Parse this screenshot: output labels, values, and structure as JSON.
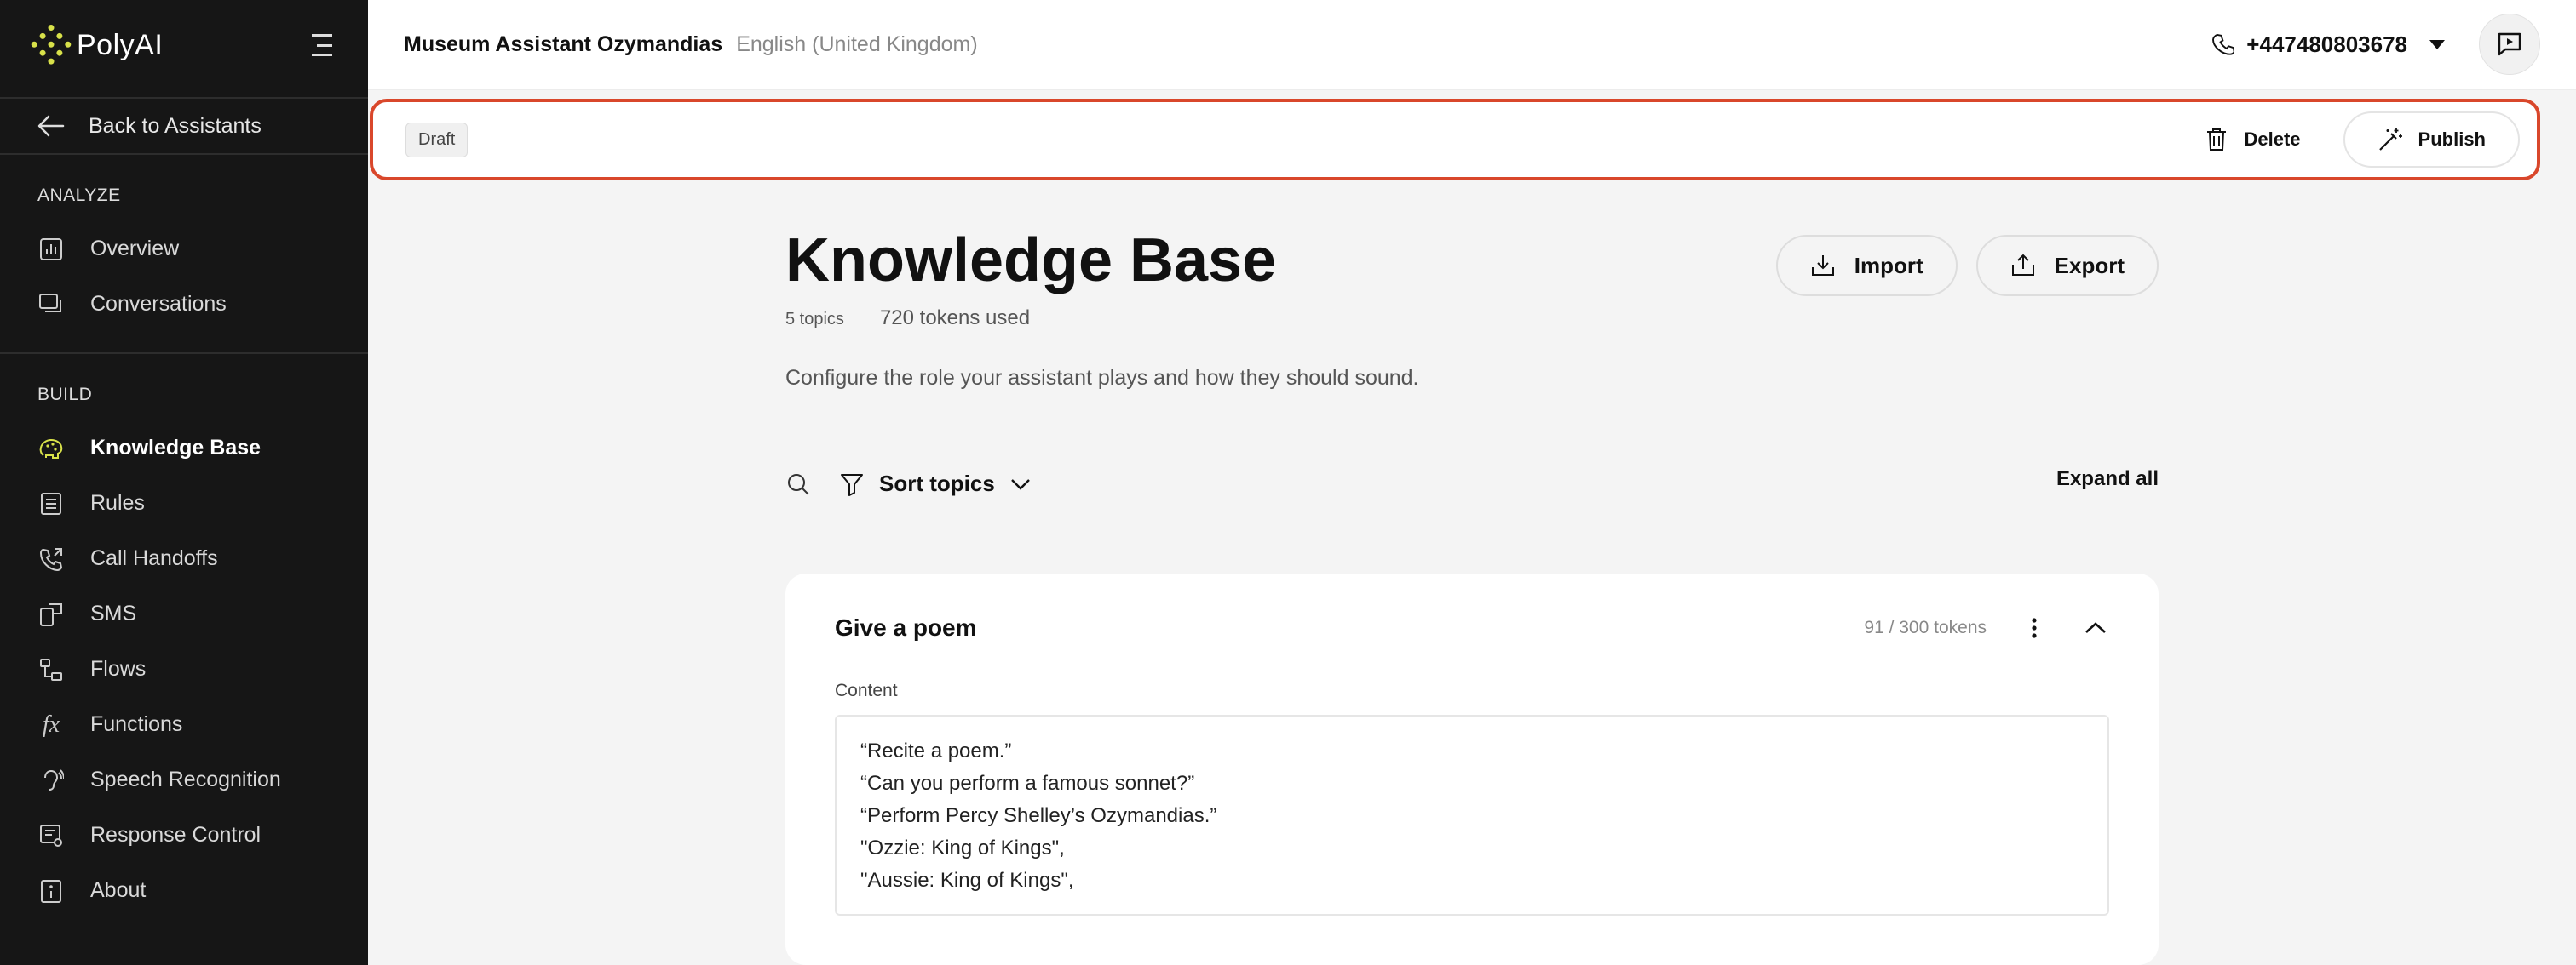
{
  "brand": {
    "name": "PolyAI",
    "logo_color": "#d8e14a"
  },
  "sidebar": {
    "back_label": "Back to Assistants",
    "analyze_label": "ANALYZE",
    "analyze_items": [
      {
        "label": "Overview",
        "icon": "bar-chart-icon"
      },
      {
        "label": "Conversations",
        "icon": "chat-bubbles-icon"
      }
    ],
    "build_label": "BUILD",
    "build_items": [
      {
        "label": "Knowledge Base",
        "icon": "brain-icon",
        "active": true
      },
      {
        "label": "Rules",
        "icon": "list-icon"
      },
      {
        "label": "Call Handoffs",
        "icon": "phone-forward-icon"
      },
      {
        "label": "SMS",
        "icon": "phone-message-icon"
      },
      {
        "label": "Flows",
        "icon": "flows-icon"
      },
      {
        "label": "Functions",
        "icon": "function-icon"
      },
      {
        "label": "Speech Recognition",
        "icon": "ear-icon"
      },
      {
        "label": "Response Control",
        "icon": "response-control-icon"
      },
      {
        "label": "About",
        "icon": "info-icon"
      }
    ]
  },
  "header": {
    "assistant_name": "Museum Assistant Ozymandias",
    "language": "English (United Kingdom)",
    "phone_number": "+447480803678"
  },
  "draft_bar": {
    "status": "Draft",
    "delete_label": "Delete",
    "publish_label": "Publish",
    "highlight_color": "#d9472b"
  },
  "main": {
    "title": "Knowledge Base",
    "topics_count": "5 topics",
    "tokens_used": "720 tokens used",
    "import_label": "Import",
    "export_label": "Export",
    "description": "Configure the role your assistant plays and how they should sound.",
    "sort_label": "Sort topics",
    "expand_all_label": "Expand all",
    "topic": {
      "title": "Give a poem",
      "token_count": "91 / 300 tokens",
      "content_label": "Content",
      "lines": [
        "“Recite a poem.”",
        "“Can you perform a famous sonnet?”",
        "“Perform Percy Shelley’s Ozymandias.”",
        "\"Ozzie: King of Kings\",",
        "\"Aussie: King of Kings\","
      ]
    }
  }
}
